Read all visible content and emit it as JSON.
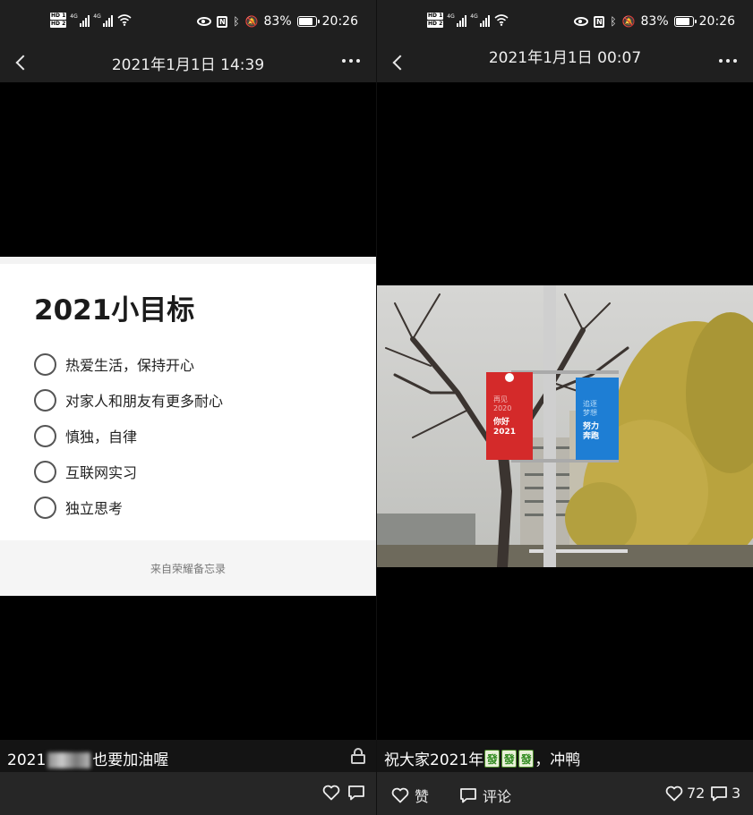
{
  "status_bar": {
    "network": "4G",
    "battery": "83%",
    "battery_level": 0.83,
    "time": "20:26",
    "hd1": "HD 1",
    "hd2": "HD 2"
  },
  "left": {
    "nav_title": "2021年1月1日 14:39",
    "memo": {
      "title": "2021小目标",
      "items": [
        "热爱生活，保持开心",
        "对家人和朋友有更多耐心",
        "慎独，自律",
        "互联网实习",
        "独立思考"
      ],
      "footer": "来自荣耀备忘录"
    },
    "caption_prefix": "2021",
    "caption_suffix": "也要加油喔"
  },
  "right": {
    "nav_title": "2021年1月1日 00:07",
    "caption_prefix": "祝大家2021年",
    "caption_suffix": "，冲鸭",
    "banner_left": [
      "再见",
      "2020",
      "你好",
      "2021"
    ],
    "banner_right": [
      "追逐",
      "梦想",
      "努力",
      "奔跑"
    ],
    "like_label": "赞",
    "comment_label": "评论",
    "like_count": "72",
    "comment_count": "3"
  },
  "colors": {
    "bar_bg": "#1f1f1f",
    "action_bg": "#262626",
    "banner_red": "#d42a2a",
    "banner_blue": "#1e7ed4"
  }
}
